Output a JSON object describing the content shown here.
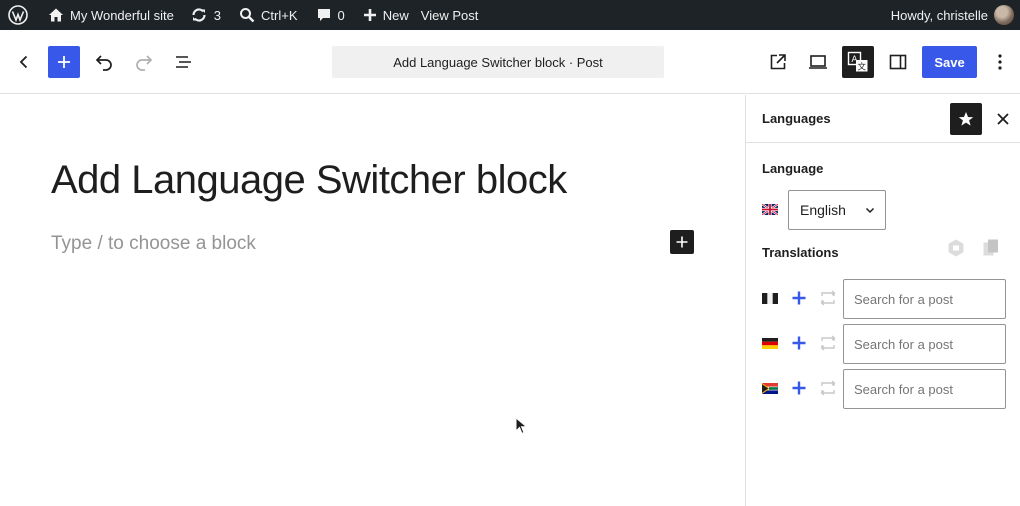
{
  "admin_bar": {
    "site_name": "My Wonderful site",
    "updates_count": "3",
    "command_shortcut": "Ctrl+K",
    "comments_count": "0",
    "new_label": "New",
    "view_post_label": "View Post",
    "greeting": "Howdy, christelle"
  },
  "header": {
    "document_title": "Add Language Switcher block · Post",
    "save_label": "Save"
  },
  "editor": {
    "post_title": "Add Language Switcher block",
    "block_placeholder": "Type / to choose a block"
  },
  "sidebar": {
    "title": "Languages",
    "language_label": "Language",
    "language_flag": "uk-flag-icon",
    "language_value": "English",
    "translations_label": "Translations",
    "translations": [
      {
        "flag": "france-flag-icon",
        "search_placeholder": "Search for a post"
      },
      {
        "flag": "germany-flag-icon",
        "search_placeholder": "Search for a post"
      },
      {
        "flag": "south-africa-flag-icon",
        "search_placeholder": "Search for a post"
      }
    ]
  },
  "colors": {
    "admin_bar_bg": "#1d2327",
    "accent": "#3858e9",
    "dark_button": "#1e1e1e",
    "placeholder_text": "#949494"
  }
}
